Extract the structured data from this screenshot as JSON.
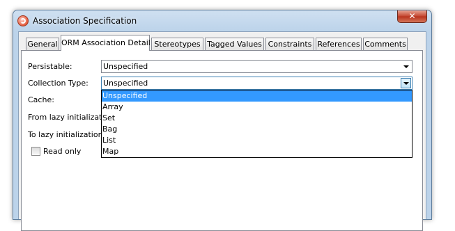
{
  "window": {
    "title": "Association Specification",
    "close_label": "✕"
  },
  "tabs": [
    {
      "label": "General",
      "active": false
    },
    {
      "label": "ORM Association Detail",
      "active": true
    },
    {
      "label": "Stereotypes",
      "active": false
    },
    {
      "label": "Tagged Values",
      "active": false
    },
    {
      "label": "Constraints",
      "active": false
    },
    {
      "label": "References",
      "active": false
    },
    {
      "label": "Comments",
      "active": false
    }
  ],
  "form": {
    "persistable": {
      "label": "Persistable:",
      "value": "Unspecified"
    },
    "collection_type": {
      "label": "Collection Type:",
      "value": "Unspecified"
    },
    "cache": {
      "label": "Cache:"
    },
    "from_lazy": {
      "label": "From lazy initialization"
    },
    "to_lazy": {
      "label": "To lazy initialization (C"
    },
    "read_only": {
      "label": "Read only",
      "checked": false
    }
  },
  "dropdown": {
    "options": [
      "Unspecified",
      "Array",
      "Set",
      "Bag",
      "List",
      "Map"
    ],
    "selected": "Unspecified"
  },
  "colors": {
    "selection": "#3399ff",
    "title_bar": "#bcd3ea"
  }
}
